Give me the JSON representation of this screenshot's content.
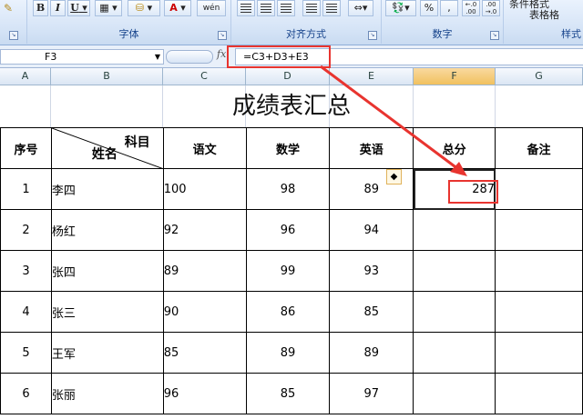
{
  "ribbon": {
    "font_buttons": [
      "B",
      "I",
      "U"
    ],
    "font_color_glyph": "A",
    "pinyin_glyph": "wén",
    "groups": {
      "font": "字体",
      "alignment": "对齐方式",
      "number": "数字",
      "styles": "样式"
    },
    "number_format": [
      "%",
      ","
    ],
    "decimal_glyphs": [
      "←.0 .00",
      ".00 →.0"
    ],
    "styles_top": "条件格式",
    "styles_table": "表格格"
  },
  "formula_bar": {
    "name_box": "F3",
    "fx": "fx",
    "formula": "=C3+D3+E3"
  },
  "columns": [
    "A",
    "B",
    "C",
    "D",
    "E",
    "F",
    "G"
  ],
  "sheet": {
    "title": "成绩表汇总",
    "headers": {
      "seq": "序号",
      "subject": "科目",
      "name": "姓名",
      "chinese": "语文",
      "math": "数学",
      "english": "英语",
      "total": "总分",
      "note": "备注"
    },
    "rows": [
      {
        "seq": "1",
        "name": "李四",
        "chinese": "100",
        "math": "98",
        "english": "89",
        "total": "287",
        "note": ""
      },
      {
        "seq": "2",
        "name": "杨红",
        "chinese": "92",
        "math": "96",
        "english": "94",
        "total": "",
        "note": ""
      },
      {
        "seq": "3",
        "name": "张四",
        "chinese": "89",
        "math": "99",
        "english": "93",
        "total": "",
        "note": ""
      },
      {
        "seq": "4",
        "name": "张三",
        "chinese": "90",
        "math": "86",
        "english": "85",
        "total": "",
        "note": ""
      },
      {
        "seq": "5",
        "name": "王军",
        "chinese": "85",
        "math": "89",
        "english": "89",
        "total": "",
        "note": ""
      },
      {
        "seq": "6",
        "name": "张丽",
        "chinese": "96",
        "math": "85",
        "english": "97",
        "total": "",
        "note": ""
      }
    ]
  },
  "annotation_color": "#e8342f"
}
